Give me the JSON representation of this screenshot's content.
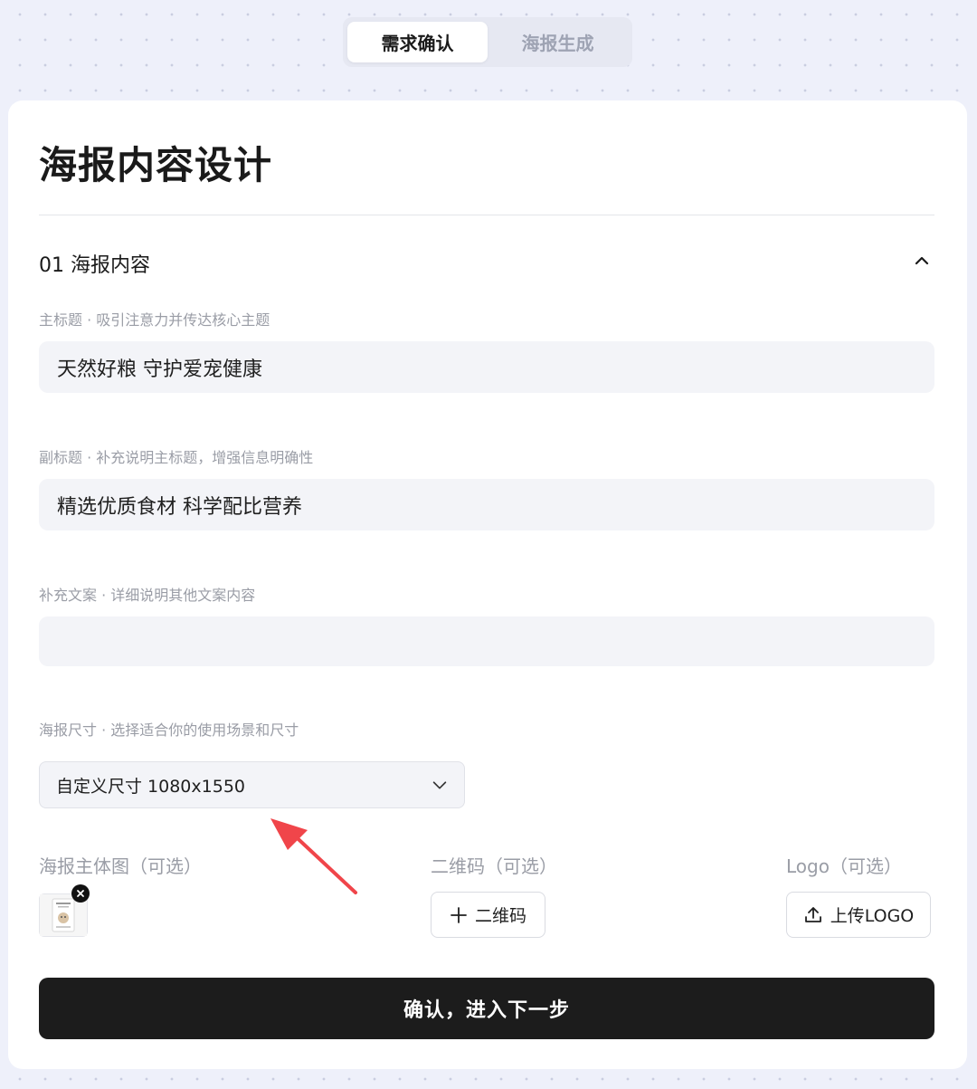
{
  "tabs": [
    {
      "label": "需求确认",
      "active": true
    },
    {
      "label": "海报生成",
      "active": false
    }
  ],
  "page_title": "海报内容设计",
  "section": {
    "title": "01 海报内容",
    "toggle_icon": "chevron-up-icon"
  },
  "fields": {
    "main_title": {
      "label": "主标题 · 吸引注意力并传达核心主题",
      "value": "天然好粮 守护爱宠健康"
    },
    "subtitle": {
      "label": "副标题 · 补充说明主标题，增强信息明确性",
      "value": "精选优质食材 科学配比营养"
    },
    "extra_copy": {
      "label": "补充文案 · 详细说明其他文案内容",
      "value": ""
    },
    "size": {
      "label": "海报尺寸 · 选择适合你的使用场景和尺寸",
      "value": "自定义尺寸 1080x1550"
    }
  },
  "uploads": {
    "main_image": {
      "label": "海报主体图（可选）"
    },
    "qr_code": {
      "label": "二维码（可选）",
      "button": "二维码"
    },
    "logo": {
      "label": "Logo（可选）",
      "button": "上传LOGO"
    }
  },
  "submit_label": "确认，进入下一步",
  "colors": {
    "accent_dark": "#1c1c1c",
    "annotation_arrow": "#f0454a"
  }
}
